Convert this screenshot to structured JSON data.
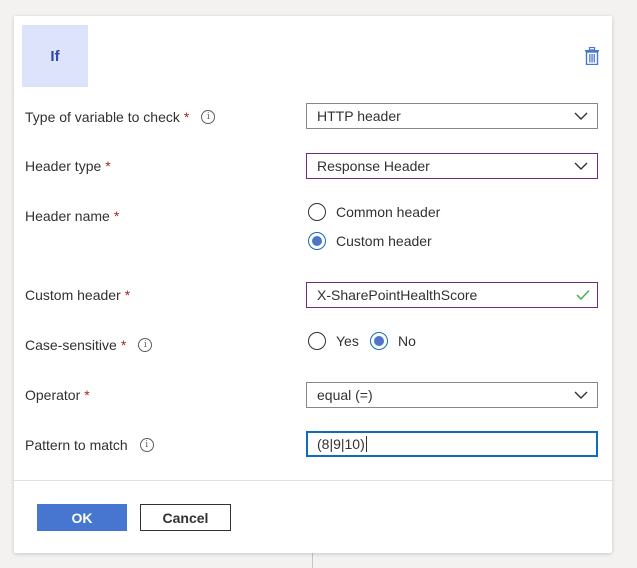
{
  "panel": {
    "tile_label": "If",
    "delete_icon": "trash-icon",
    "accent_color": "#4776d1"
  },
  "fields": {
    "variable_type": {
      "label": "Type of variable to check",
      "required": "*",
      "value": "HTTP header"
    },
    "header_type": {
      "label": "Header type",
      "required": "*",
      "value": "Response Header"
    },
    "header_name": {
      "label": "Header name",
      "required": "*",
      "options": [
        "Common header",
        "Custom header"
      ],
      "selected": "Custom header"
    },
    "custom_header": {
      "label": "Custom header",
      "required": "*",
      "value": "X-SharePointHealthScore",
      "valid": true
    },
    "case_sensitive": {
      "label": "Case-sensitive",
      "required": "*",
      "options": [
        "Yes",
        "No"
      ],
      "selected": "No"
    },
    "operator": {
      "label": "Operator",
      "required": "*",
      "value": "equal (=)"
    },
    "pattern": {
      "label": "Pattern to match",
      "value": "(8|9|10)"
    }
  },
  "footer": {
    "ok_label": "OK",
    "cancel_label": "Cancel"
  }
}
